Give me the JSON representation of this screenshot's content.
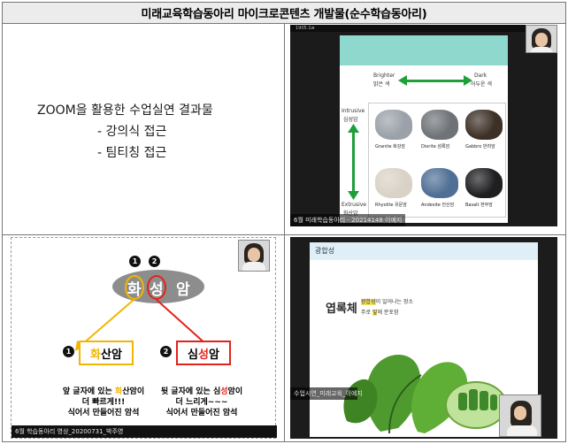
{
  "title": "미래교육학습동아리 마이크로콘텐츠 개발물(순수학습동아리)",
  "intro": {
    "heading": "ZOOM을 활용한 수업실연 결과물",
    "items": [
      "- 강의식 접근",
      "- 팀티칭 접근"
    ]
  },
  "rock_slide": {
    "top_bar": "1905.1w",
    "brighter": "Brighter",
    "brighter_ko": "밝은 색",
    "dark": "Dark",
    "dark_ko": "어두운 색",
    "intrusive": "Intrusive",
    "intrusive_ko": "심성암",
    "extrusive": "Extrusive",
    "extrusive_ko": "화산암",
    "rocks": [
      {
        "label": "Granite 화강암",
        "color": "#9aa1a8"
      },
      {
        "label": "Diorite 섬록암",
        "color": "#6f7377"
      },
      {
        "label": "Gabbro 반려암",
        "color": "#3d3026"
      },
      {
        "label": "Rhyolite 유문암",
        "color": "#d9d2c6"
      },
      {
        "label": "Andesite 안산암",
        "color": "#4f6f95"
      },
      {
        "label": "Basalt 현무암",
        "color": "#1f1f22"
      }
    ],
    "caption": "6월 미래학습동아리 - 20214148 이예지"
  },
  "rock_type_slide": {
    "char1": "화",
    "char2": "성",
    "char3": "암",
    "num1": "1",
    "num2": "2",
    "box1_char": "화",
    "box1_rest": "산암",
    "box2_pre": "심",
    "box2_char": "성",
    "box2_rest": "암",
    "desc1_line1_pre": "앞 글자에 있는 ",
    "desc1_line1_hl": "화",
    "desc1_line1_post": "산암이",
    "desc1_line2": "더 빠르게!!!",
    "desc1_line3": "식어서 만들어진 암석",
    "desc2_line1_pre": "뒷 글자에 있는 심",
    "desc2_line1_hl": "성",
    "desc2_line1_post": "암이",
    "desc2_line2": "더 느리게~~~",
    "desc2_line3": "식어서 만들어진 암석",
    "caption": "6월 학습동아리 영상_20200731_박주영"
  },
  "photo_slide": {
    "header": "광합성",
    "heading": "엽록체",
    "line1_hl": "광합성",
    "line1_rest": "이 일어나는 장소",
    "line2_pre": "주로 ",
    "line2_hl": "잎",
    "line2_rest": "에 분포함",
    "caption": "수업시연_미래교육_이예지"
  },
  "colors": {
    "yellow": "#f2b600",
    "red": "#e2231a",
    "teal": "#8fd8cd",
    "green_arrow": "#1f9e3a"
  }
}
